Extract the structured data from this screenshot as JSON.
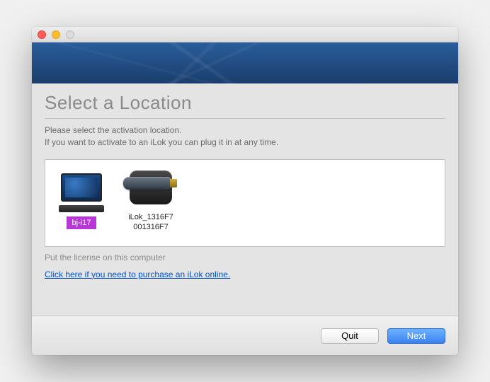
{
  "heading": "Select a Location",
  "instructions_line1": "Please select the activation location.",
  "instructions_line2": "If you want to activate to an iLok you can plug it in at any time.",
  "locations": {
    "computer": {
      "label": "bj-i17"
    },
    "ilok": {
      "name": "iLok_1316F7",
      "serial": "001316F7"
    }
  },
  "hint": "Put the license on this computer",
  "purchase_link": "Click here if you need to purchase an iLok online.",
  "buttons": {
    "quit": "Quit",
    "next": "Next"
  }
}
